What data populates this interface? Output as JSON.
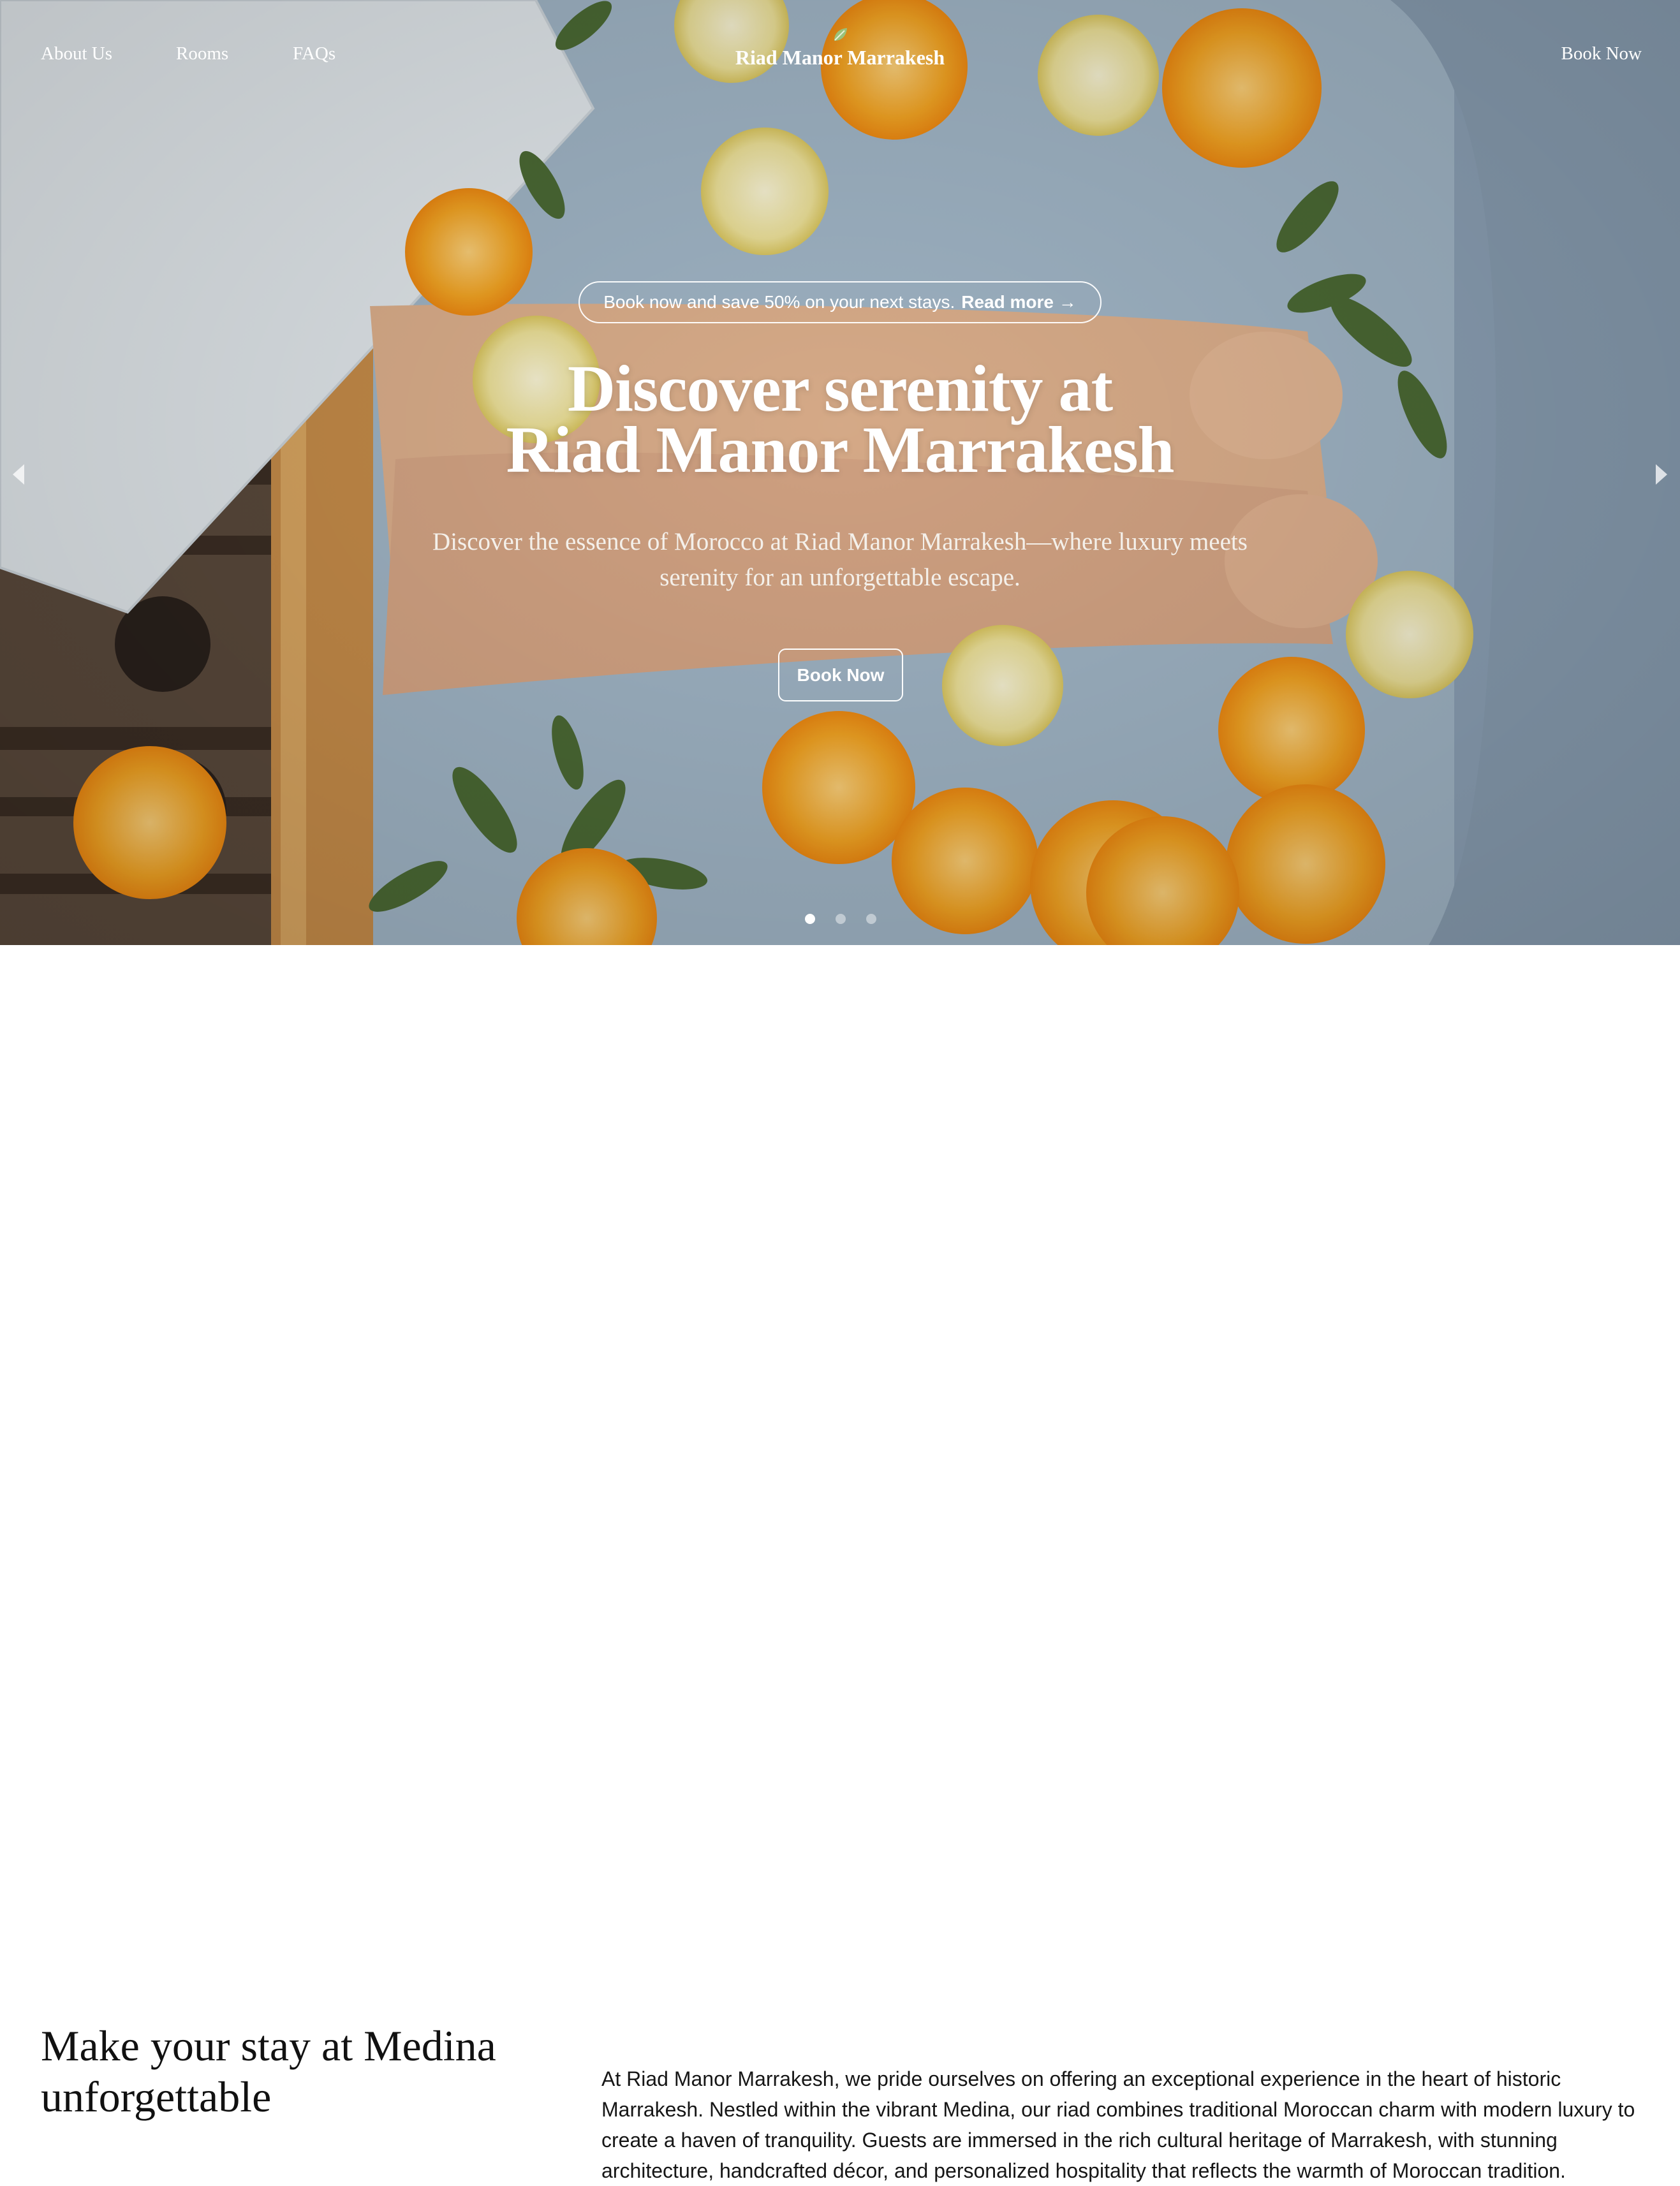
{
  "nav": {
    "links": [
      "About Us",
      "Rooms",
      "FAQs"
    ],
    "brand": "Riad Manor Marrakesh",
    "book_label": "Book Now"
  },
  "hero": {
    "promo_text": "Book now and save 50% on your next stays.",
    "promo_link": "Read more →",
    "title_line1": "Discover serenity at",
    "title_line2": "Riad Manor Marrakesh",
    "subtitle": "Discover the essence of Morocco at Riad Manor Marrakesh—where luxury meets serenity for an unforgettable escape.",
    "cta_label": "Book Now",
    "slides_count": 3,
    "active_slide": 1
  },
  "intro": {
    "title": "Make your stay at Medina unforgettable",
    "text": "At Riad Manor Marrakesh, we pride ourselves on offering an exceptional experience in the heart of historic Marrakesh. Nestled within the vibrant Medina, our riad combines traditional Moroccan charm with modern luxury to create a haven of tranquility. Guests are immersed in the rich cultural heritage of Marrakesh, with stunning architecture, handcrafted décor, and personalized hospitality that reflects the warmth of Moroccan tradition."
  },
  "colors": {
    "water": "#a3b8c9",
    "orange": "#f5a524",
    "lemon": "#efe39a",
    "leaf": "#4c6b35",
    "text_dark": "#111111"
  }
}
